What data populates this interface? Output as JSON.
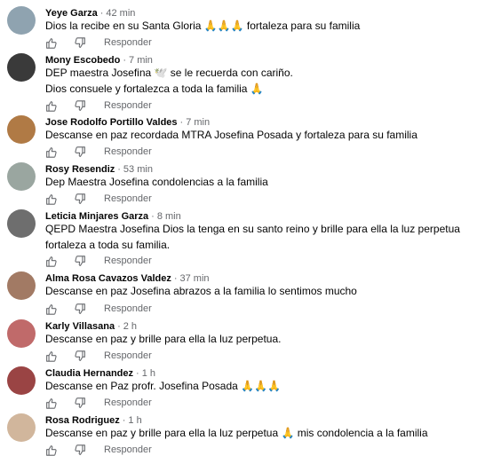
{
  "comments": [
    {
      "name": "Yeye Garza",
      "time": "42 min",
      "lines": [
        "Dios la recibe en su Santa Gloria 🙏🙏🙏 fortaleza para su familia"
      ],
      "reply": "Responder",
      "avatar_color": "#8fa3b0"
    },
    {
      "name": "Mony Escobedo",
      "time": "7 min",
      "lines": [
        "DEP maestra Josefina 🕊️ se le recuerda con cariño.",
        "Dios consuele y fortalezca a toda la familia 🙏"
      ],
      "reply": "Responder",
      "avatar_color": "#3a3a3a"
    },
    {
      "name": "Jose Rodolfo Portillo Valdes",
      "time": "7 min",
      "lines": [
        "Descanse en paz recordada MTRA Josefina Posada y fortaleza para su familia"
      ],
      "reply": "Responder",
      "avatar_color": "#b07a45"
    },
    {
      "name": "Rosy Resendiz",
      "time": "53 min",
      "lines": [
        "Dep Maestra Josefina condolencias a la familia"
      ],
      "reply": "Responder",
      "avatar_color": "#9aa6a0"
    },
    {
      "name": "Leticia Minjares Garza",
      "time": "8 min",
      "lines": [
        "QEPD Maestra Josefina Dios la tenga en su santo reino y brille para ella la luz perpetua",
        "fortaleza a toda su familia."
      ],
      "reply": "Responder",
      "avatar_color": "#6e6e6e"
    },
    {
      "name": "Alma Rosa Cavazos Valdez",
      "time": "37 min",
      "lines": [
        "Descanse en paz Josefina abrazos a la familia lo sentimos mucho"
      ],
      "reply": "Responder",
      "avatar_color": "#a27a64"
    },
    {
      "name": "Karly Villasana",
      "time": "2 h",
      "lines": [
        "Descanse en paz y brille para ella la luz perpetua."
      ],
      "reply": "Responder",
      "avatar_color": "#c06a6a"
    },
    {
      "name": "Claudia Hernandez",
      "time": "1 h",
      "lines": [
        "Descanse en Paz profr. Josefina Posada 🙏🙏🙏"
      ],
      "reply": "Responder",
      "avatar_color": "#9a4444"
    },
    {
      "name": "Rosa Rodriguez",
      "time": "1 h",
      "lines": [
        "Descanse en paz y brille para ella la luz perpetua 🙏 mis condolencia a la familia"
      ],
      "reply": "Responder",
      "avatar_color": "#d1b69c"
    }
  ]
}
